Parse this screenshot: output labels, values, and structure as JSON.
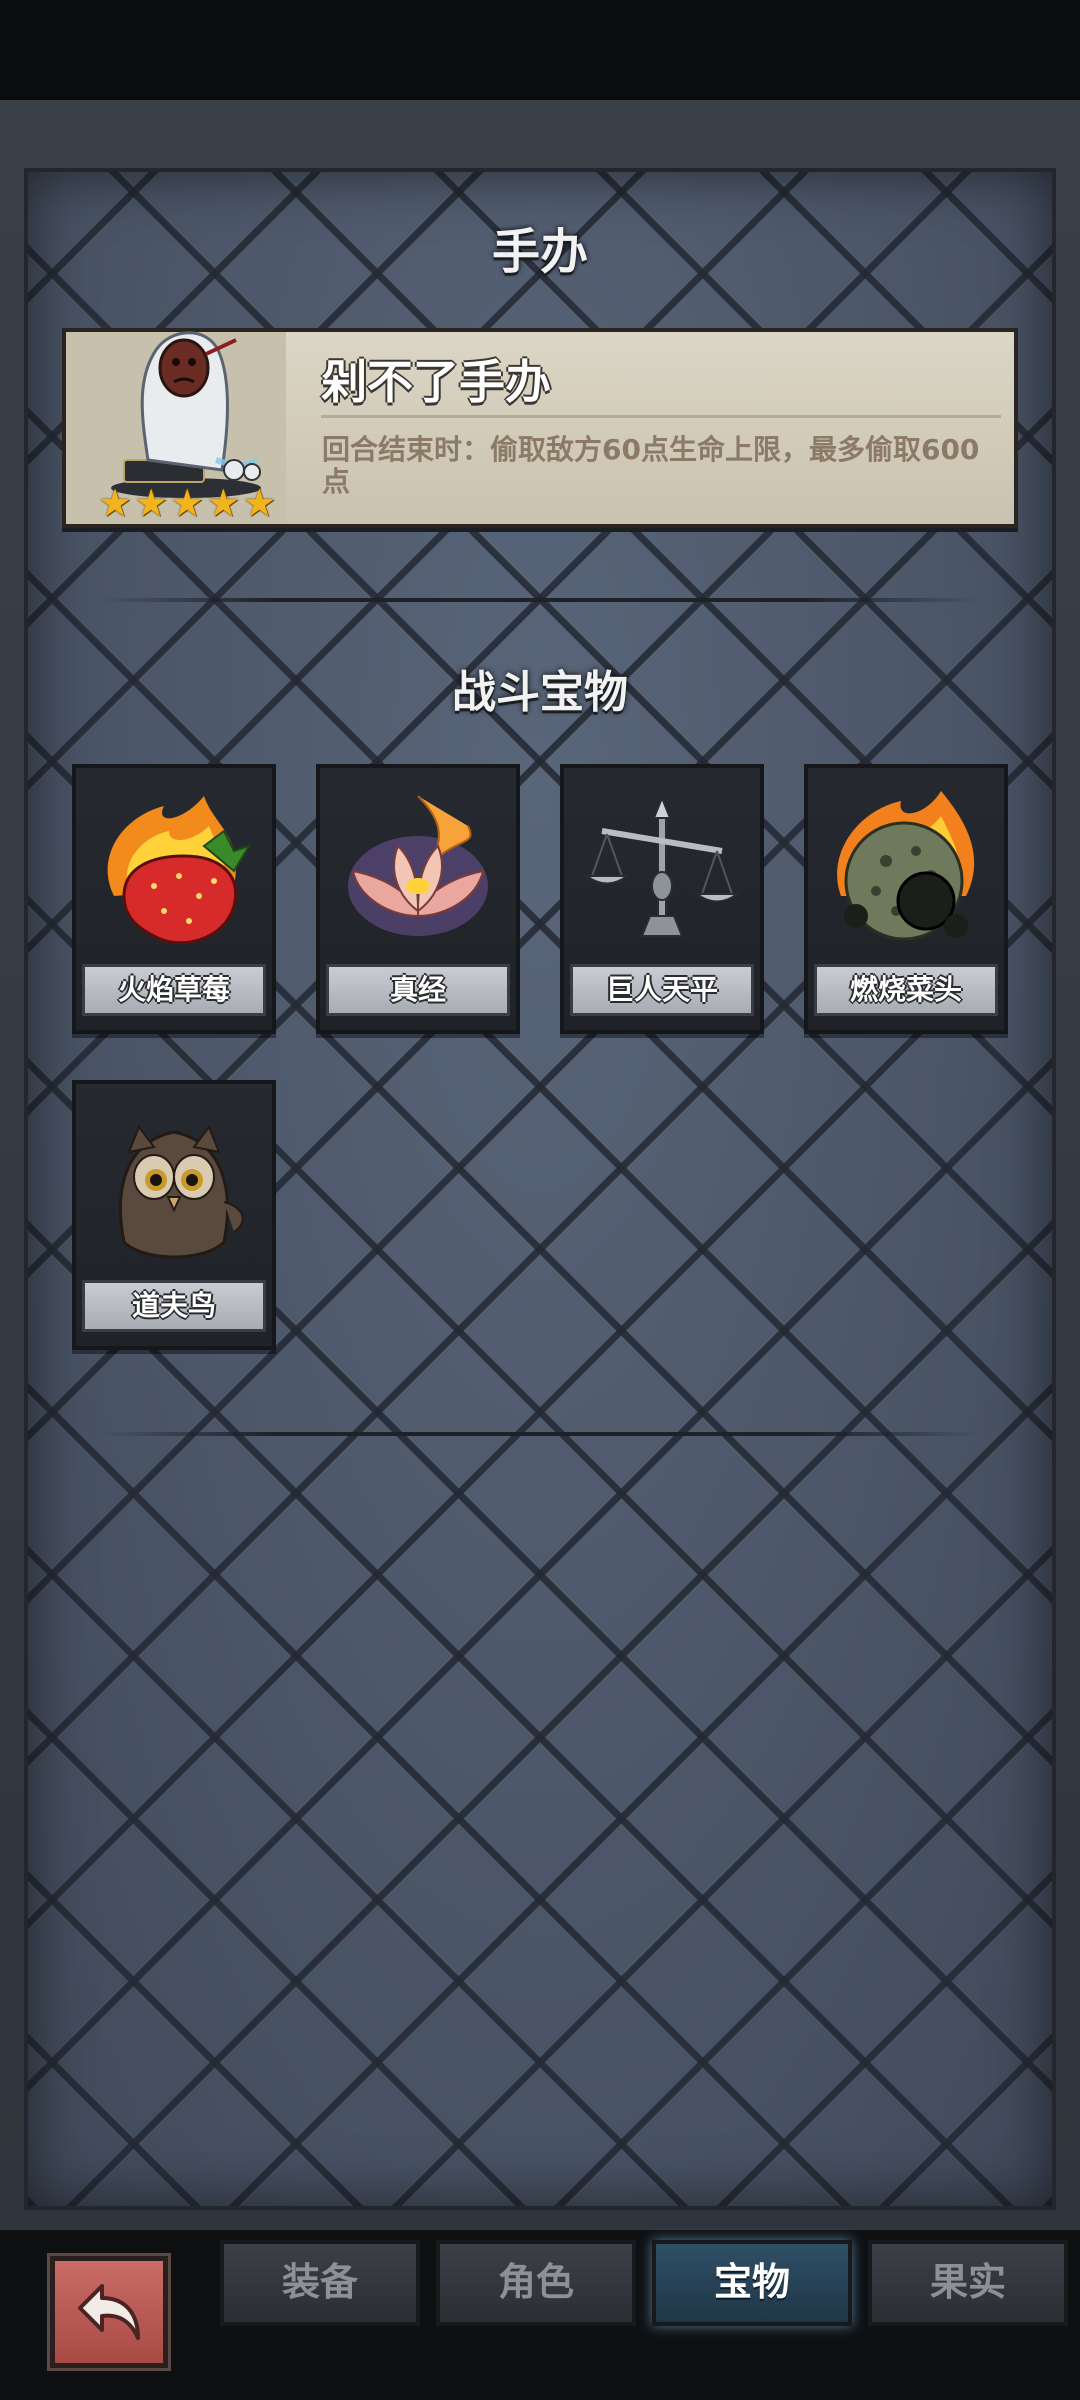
{
  "header": {
    "title": "手办"
  },
  "figure_card": {
    "name": "剁不了手办",
    "description": "回合结束时：偷取敌方60点生命上限，最多偷取600点",
    "stars": 5
  },
  "treasures": {
    "title": "战斗宝物",
    "items": [
      {
        "label": "火焰草莓",
        "icon": "flaming-strawberry-icon"
      },
      {
        "label": "真经",
        "icon": "lotus-scripture-icon"
      },
      {
        "label": "巨人天平",
        "icon": "giant-scale-icon"
      },
      {
        "label": "燃烧菜头",
        "icon": "burning-turnip-icon"
      },
      {
        "label": "道夫鸟",
        "icon": "owl-bird-icon"
      }
    ]
  },
  "bottom_nav": {
    "back_icon": "back-arrow-icon",
    "tabs": [
      {
        "label": "装备",
        "active": false
      },
      {
        "label": "角色",
        "active": false
      },
      {
        "label": "宝物",
        "active": true
      },
      {
        "label": "果实",
        "active": false
      }
    ]
  }
}
